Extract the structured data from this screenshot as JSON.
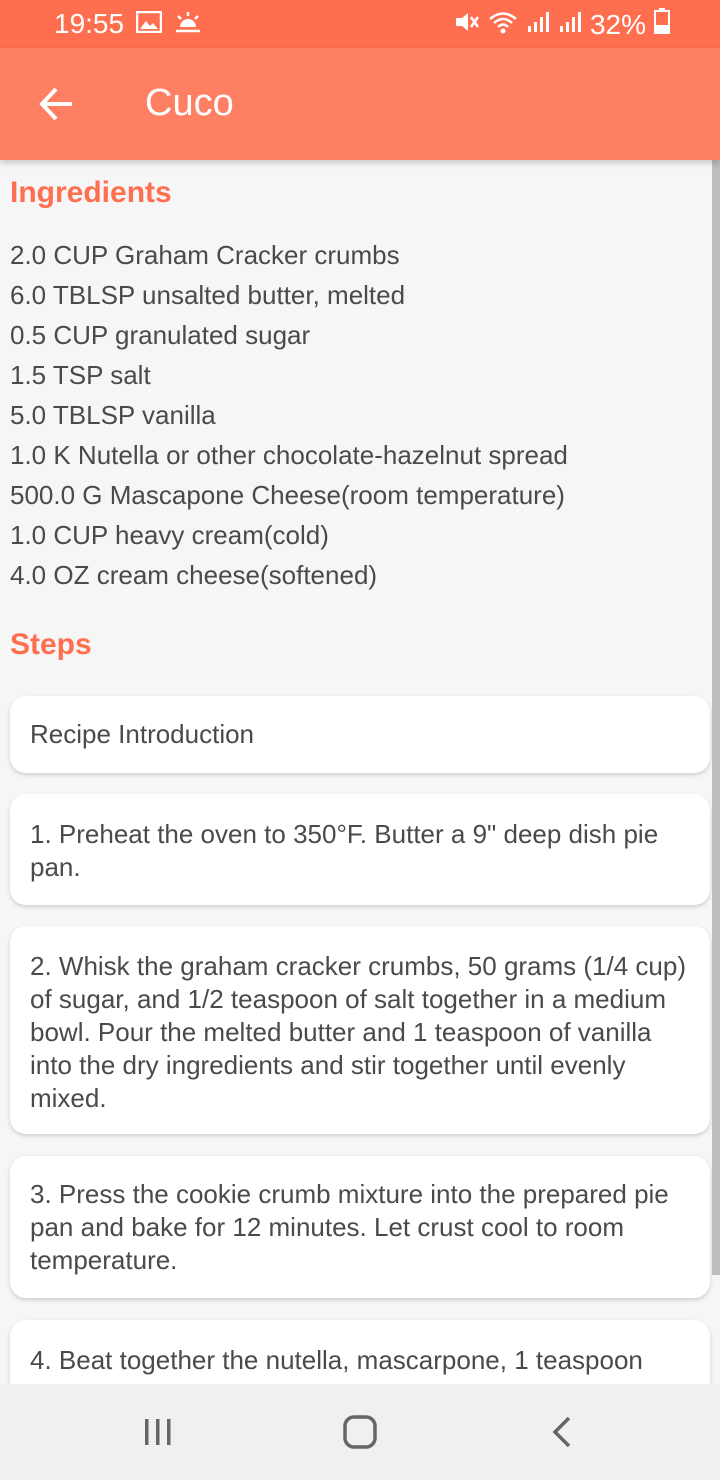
{
  "status_bar": {
    "time": "19:55",
    "battery": "32%",
    "icons": [
      "gallery-icon",
      "weather-icon",
      "mute-icon",
      "wifi-icon",
      "signal-icon",
      "signal-icon",
      "battery-icon"
    ]
  },
  "app_bar": {
    "title": "Cuco",
    "back_icon": "arrow-left-icon"
  },
  "ingredients": {
    "title": "Ingredients",
    "items": [
      "2.0 CUP Graham Cracker crumbs",
      "6.0 TBLSP unsalted butter, melted",
      "0.5 CUP granulated sugar",
      "1.5 TSP salt",
      "5.0 TBLSP vanilla",
      "1.0 K Nutella or other chocolate-hazelnut spread",
      "500.0 G Mascapone Cheese(room temperature)",
      "1.0 CUP heavy cream(cold)",
      "4.0 OZ cream cheese(softened)"
    ]
  },
  "steps": {
    "title": "Steps",
    "items": [
      "Recipe Introduction",
      "1. Preheat the oven to 350°F. Butter a 9\" deep dish pie pan.",
      "2. Whisk the graham cracker crumbs, 50 grams (1/4 cup) of sugar, and 1/2 teaspoon of salt together in a medium bowl. Pour the melted butter and 1 teaspoon of vanilla into the dry ingredients and stir together until evenly mixed.",
      "3. Press the cookie crumb mixture into the prepared pie pan and bake for 12 minutes. Let crust cool to room temperature.",
      "4. Beat together the nutella, mascarpone, 1 teaspoon"
    ]
  },
  "nav_bar": {
    "icons": [
      "recent-apps-icon",
      "home-icon",
      "back-icon"
    ]
  },
  "colors": {
    "accent": "#ff6e4f",
    "app_bar": "#ff7f62",
    "background": "#f6f6f6",
    "card": "#ffffff",
    "text": "#4a4a4a"
  }
}
